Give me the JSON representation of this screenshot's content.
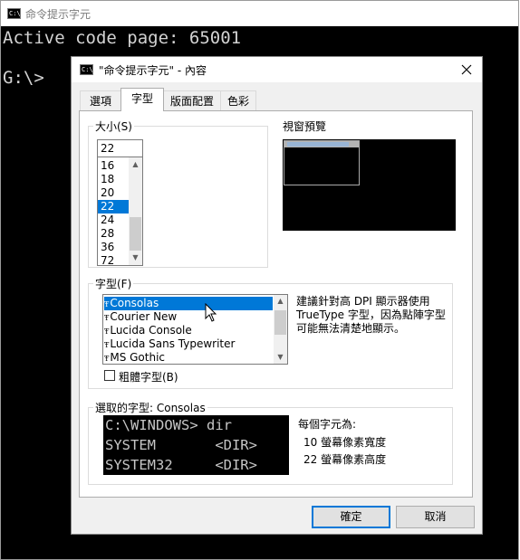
{
  "console": {
    "title": "命令提示字元",
    "lines": [
      "Active code page: 65001",
      "",
      "G:\\>"
    ]
  },
  "dialog": {
    "title": "\"命令提示字元\" - 內容",
    "close_icon": "close-icon",
    "tabs": [
      {
        "label": "選項"
      },
      {
        "label": "字型",
        "active": true
      },
      {
        "label": "版面配置"
      },
      {
        "label": "色彩"
      }
    ],
    "size_group": {
      "label": "大小(S)",
      "input_value": "22",
      "options": [
        "16",
        "18",
        "20",
        "22",
        "24",
        "28",
        "36",
        "72"
      ],
      "selected": "22"
    },
    "preview_group": {
      "label": "視窗預覽"
    },
    "font_group": {
      "label": "字型(F)",
      "fonts": [
        "Consolas",
        "Courier New",
        "Lucida Console",
        "Lucida Sans Typewriter",
        "MS Gothic"
      ],
      "selected": "Consolas",
      "truetype_glyph": "Ŧ",
      "info_lines": [
        "建議針對高 DPI 顯示器使用",
        "TrueType 字型，因為點陣字型",
        "可能無法清楚地顯示。"
      ],
      "bold_label": "粗體字型(B)",
      "bold_checked": false
    },
    "selected_font_group": {
      "label": "選取的字型: Consolas",
      "sample_lines": [
        "C:\\WINDOWS> dir",
        "SYSTEM       <DIR>",
        "SYSTEM32     <DIR>"
      ],
      "char_size_title": "每個字元為:",
      "width_text": "10 螢幕像素寬度",
      "height_text": "22 螢幕像素高度"
    },
    "buttons": {
      "ok": "確定",
      "cancel": "取消"
    }
  },
  "icons": {
    "cmd": "command-prompt-icon",
    "cursor": "mouse-pointer-icon",
    "scroll_up": "chevron-up-icon",
    "scroll_down": "chevron-down-icon"
  }
}
